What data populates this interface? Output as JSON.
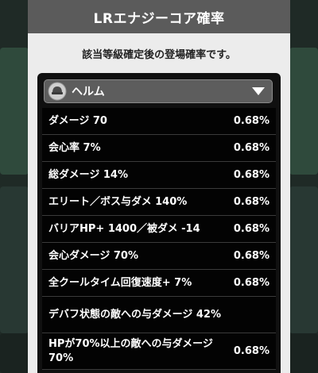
{
  "dialog": {
    "title": "LRエナジーコア確率",
    "subtitle": "該当等級確定後の登場確率です。"
  },
  "dropdown": {
    "selected": "ヘルム",
    "icon": "helmet-icon"
  },
  "rates": [
    {
      "stat": "ダメージ 70",
      "rate": "0.68%"
    },
    {
      "stat": "会心率 7%",
      "rate": "0.68%"
    },
    {
      "stat": "総ダメージ 14%",
      "rate": "0.68%"
    },
    {
      "stat": "エリート／ボス与ダメ 140%",
      "rate": "0.68%"
    },
    {
      "stat": "バリアHP+ 1400／被ダメ -14",
      "rate": "0.68%"
    },
    {
      "stat": "会心ダメージ 70%",
      "rate": "0.68%"
    },
    {
      "stat": "全クールタイム回復速度+ 7%",
      "rate": "0.68%"
    },
    {
      "stat": "デバフ状態の敵への与ダメージ 42%",
      "rate": ""
    },
    {
      "stat": "HPが70%以上の敵への与ダメージ 70%",
      "rate": "0.68%"
    }
  ],
  "colors": {
    "header": "#5b5b5b",
    "dialog_bg": "#ececec",
    "panel": "#101010"
  }
}
